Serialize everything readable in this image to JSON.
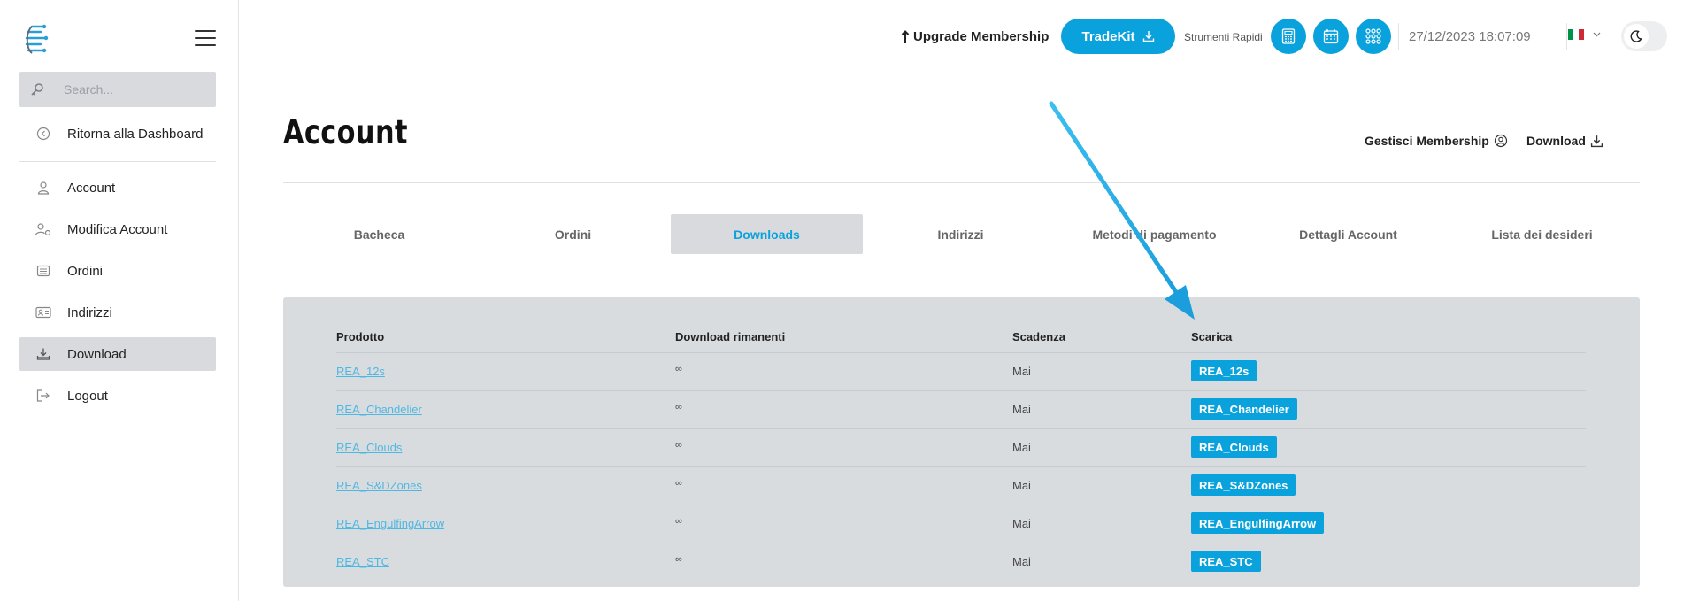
{
  "sidebar": {
    "search_placeholder": "Search...",
    "items": [
      {
        "label": "Ritorna alla Dashboard",
        "icon": "back-circle-icon"
      },
      {
        "label": "Account",
        "icon": "user-icon"
      },
      {
        "label": "Modifica Account",
        "icon": "user-gear-icon"
      },
      {
        "label": "Ordini",
        "icon": "orders-icon"
      },
      {
        "label": "Indirizzi",
        "icon": "address-card-icon"
      },
      {
        "label": "Download",
        "icon": "download-tray-icon"
      },
      {
        "label": "Logout",
        "icon": "logout-icon"
      }
    ],
    "active_item": "Download"
  },
  "topbar": {
    "upgrade_label": "Upgrade Membership",
    "tradekit_label": "TradeKit",
    "strumenti_label": "Strumenti Rapidi",
    "datetime": "27/12/2023 18:07:09",
    "accent_color": "#0aa2dc"
  },
  "main": {
    "title": "Account",
    "gestisci_label": "Gestisci Membership",
    "download_label": "Download",
    "tabs": [
      {
        "label": "Bacheca"
      },
      {
        "label": "Ordini"
      },
      {
        "label": "Downloads"
      },
      {
        "label": "Indirizzi"
      },
      {
        "label": "Metodi di pagamento"
      },
      {
        "label": "Dettagli Account"
      },
      {
        "label": "Lista dei desideri"
      }
    ],
    "active_tab": "Downloads",
    "table": {
      "headers": [
        "Prodotto",
        "Download rimanenti",
        "Scadenza",
        "Scarica"
      ],
      "rows": [
        {
          "product": "REA_12s",
          "remaining": "∞",
          "expiry": "Mai",
          "button": "REA_12s"
        },
        {
          "product": "REA_Chandelier",
          "remaining": "∞",
          "expiry": "Mai",
          "button": "REA_Chandelier"
        },
        {
          "product": "REA_Clouds",
          "remaining": "∞",
          "expiry": "Mai",
          "button": "REA_Clouds"
        },
        {
          "product": "REA_S&DZones",
          "remaining": "∞",
          "expiry": "Mai",
          "button": "REA_S&DZones"
        },
        {
          "product": "REA_EngulfingArrow",
          "remaining": "∞",
          "expiry": "Mai",
          "button": "REA_EngulfingArrow"
        },
        {
          "product": "REA_STC",
          "remaining": "∞",
          "expiry": "Mai",
          "button": "REA_STC"
        }
      ]
    }
  }
}
